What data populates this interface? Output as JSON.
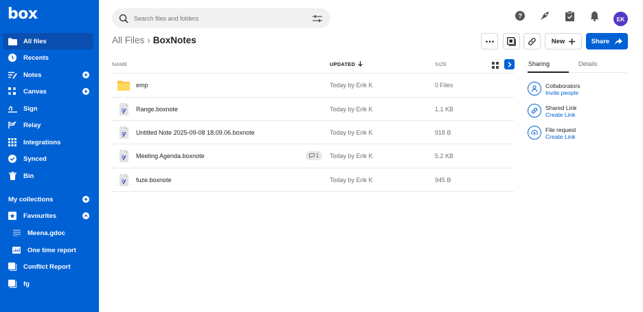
{
  "app": {
    "logo": "box"
  },
  "colors": {
    "brand": "#0061d5",
    "avatar": "#5438c8"
  },
  "sidebar": {
    "items": [
      {
        "label": "All files",
        "icon": "folder-icon",
        "active": true
      },
      {
        "label": "Recents",
        "icon": "clock-icon"
      },
      {
        "label": "Notes",
        "icon": "notes-icon",
        "add": true
      },
      {
        "label": "Canvas",
        "icon": "canvas-icon",
        "add": true
      },
      {
        "label": "Sign",
        "icon": "sign-icon"
      },
      {
        "label": "Relay",
        "icon": "relay-icon"
      },
      {
        "label": "Integrations",
        "icon": "grid-icon"
      },
      {
        "label": "Synced",
        "icon": "check-circle-icon"
      },
      {
        "label": "Bin",
        "icon": "trash-icon"
      }
    ],
    "collections": {
      "label": "My collections",
      "items": [
        {
          "label": "Favourites",
          "icon": "star-box-icon"
        },
        {
          "label": "Meena.gdoc",
          "icon": "doc-lines-icon",
          "sub": true
        },
        {
          "label": "One time report",
          "icon": "report-icon",
          "sub": true
        },
        {
          "label": "Conflict Report",
          "icon": "collection-icon"
        },
        {
          "label": "fg",
          "icon": "collection-icon"
        }
      ]
    }
  },
  "search": {
    "placeholder": "Search files and folders"
  },
  "header": {
    "avatar_initials": "EK"
  },
  "breadcrumb": {
    "parent": "All Files",
    "current": "BoxNotes"
  },
  "toolbar": {
    "new_label": "New",
    "share_label": "Share"
  },
  "table": {
    "headers": {
      "name": "NAME",
      "updated": "UPDATED",
      "size": "SIZE"
    },
    "rows": [
      {
        "name": "emp",
        "type": "folder",
        "updated": "Today by Erik K",
        "size": "0 Files"
      },
      {
        "name": "Range.boxnote",
        "type": "boxnote",
        "updated": "Today by Erik K",
        "size": "1.1 KB"
      },
      {
        "name": "Untitled Note 2025-09-08 18.09.06.boxnote",
        "type": "boxnote",
        "updated": "Today by Erik K",
        "size": "918 B"
      },
      {
        "name": "Meeting Agenda.boxnote",
        "type": "boxnote",
        "updated": "Today by Erik K",
        "size": "5.2 KB",
        "comments": "1"
      },
      {
        "name": "fuze.boxnote",
        "type": "boxnote",
        "updated": "Today by Erik K",
        "size": "945 B"
      }
    ]
  },
  "panel": {
    "tabs": {
      "sharing": "Sharing",
      "details": "Details"
    },
    "items": [
      {
        "title": "Collaborators",
        "action": "Invite people",
        "icon": "person-icon"
      },
      {
        "title": "Shared Link",
        "action": "Create Link",
        "icon": "link-icon"
      },
      {
        "title": "File request",
        "action": "Create Link",
        "icon": "upload-icon"
      }
    ]
  }
}
